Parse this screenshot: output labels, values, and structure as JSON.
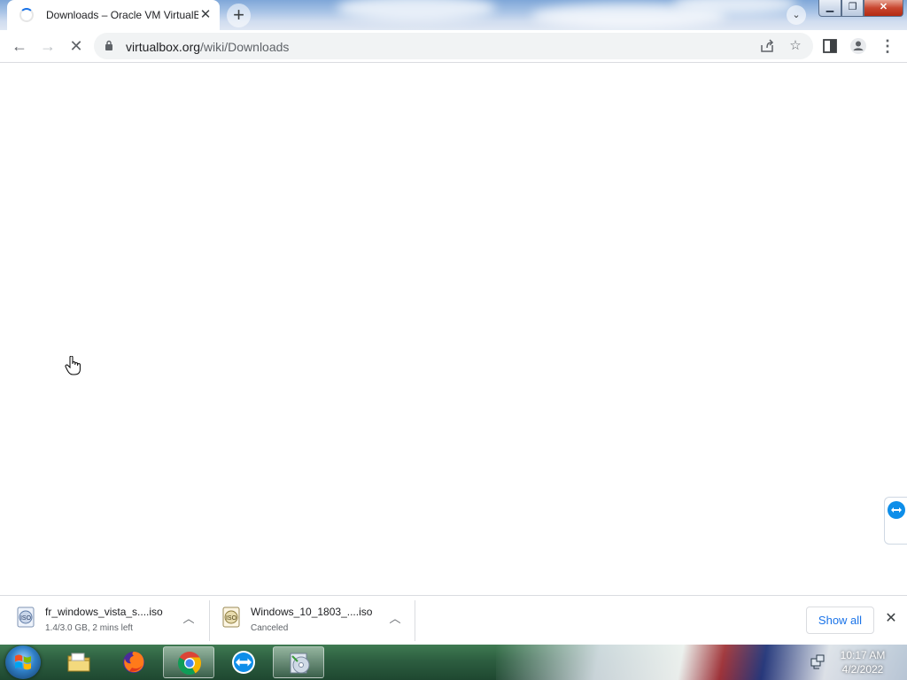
{
  "browser": {
    "tab": {
      "title": "Downloads – Oracle VM VirtualBox",
      "close_label": "✕"
    },
    "new_tab_label": "+",
    "tab_search_label": "⌄",
    "window_buttons": {
      "minimize": "▁",
      "maximize": "❐",
      "close": "✕"
    }
  },
  "toolbar": {
    "back": "←",
    "forward": "→",
    "stop": "✕",
    "url_host": "virtualbox.org",
    "url_path": "/wiki/Downloads"
  },
  "download_shelf": {
    "items": [
      {
        "name": "fr_windows_vista_s....iso",
        "status": "1.4/3.0 GB, 2 mins left",
        "icon": "iso-file-icon"
      },
      {
        "name": "Windows_10_1803_....iso",
        "status": "Canceled",
        "icon": "iso-file-icon"
      }
    ],
    "show_all_label": "Show all",
    "close_label": "✕"
  },
  "taskbar": {
    "apps": [
      "file-explorer",
      "firefox",
      "chrome",
      "teamviewer",
      "disc-burner"
    ],
    "active_app": "chrome",
    "time": "10:17 AM",
    "date": "4/2/2022"
  },
  "colors": {
    "accent": "#1a73e8",
    "teamviewer_blue": "#0e8ee9",
    "taskbar_green": "#2d5e40"
  }
}
